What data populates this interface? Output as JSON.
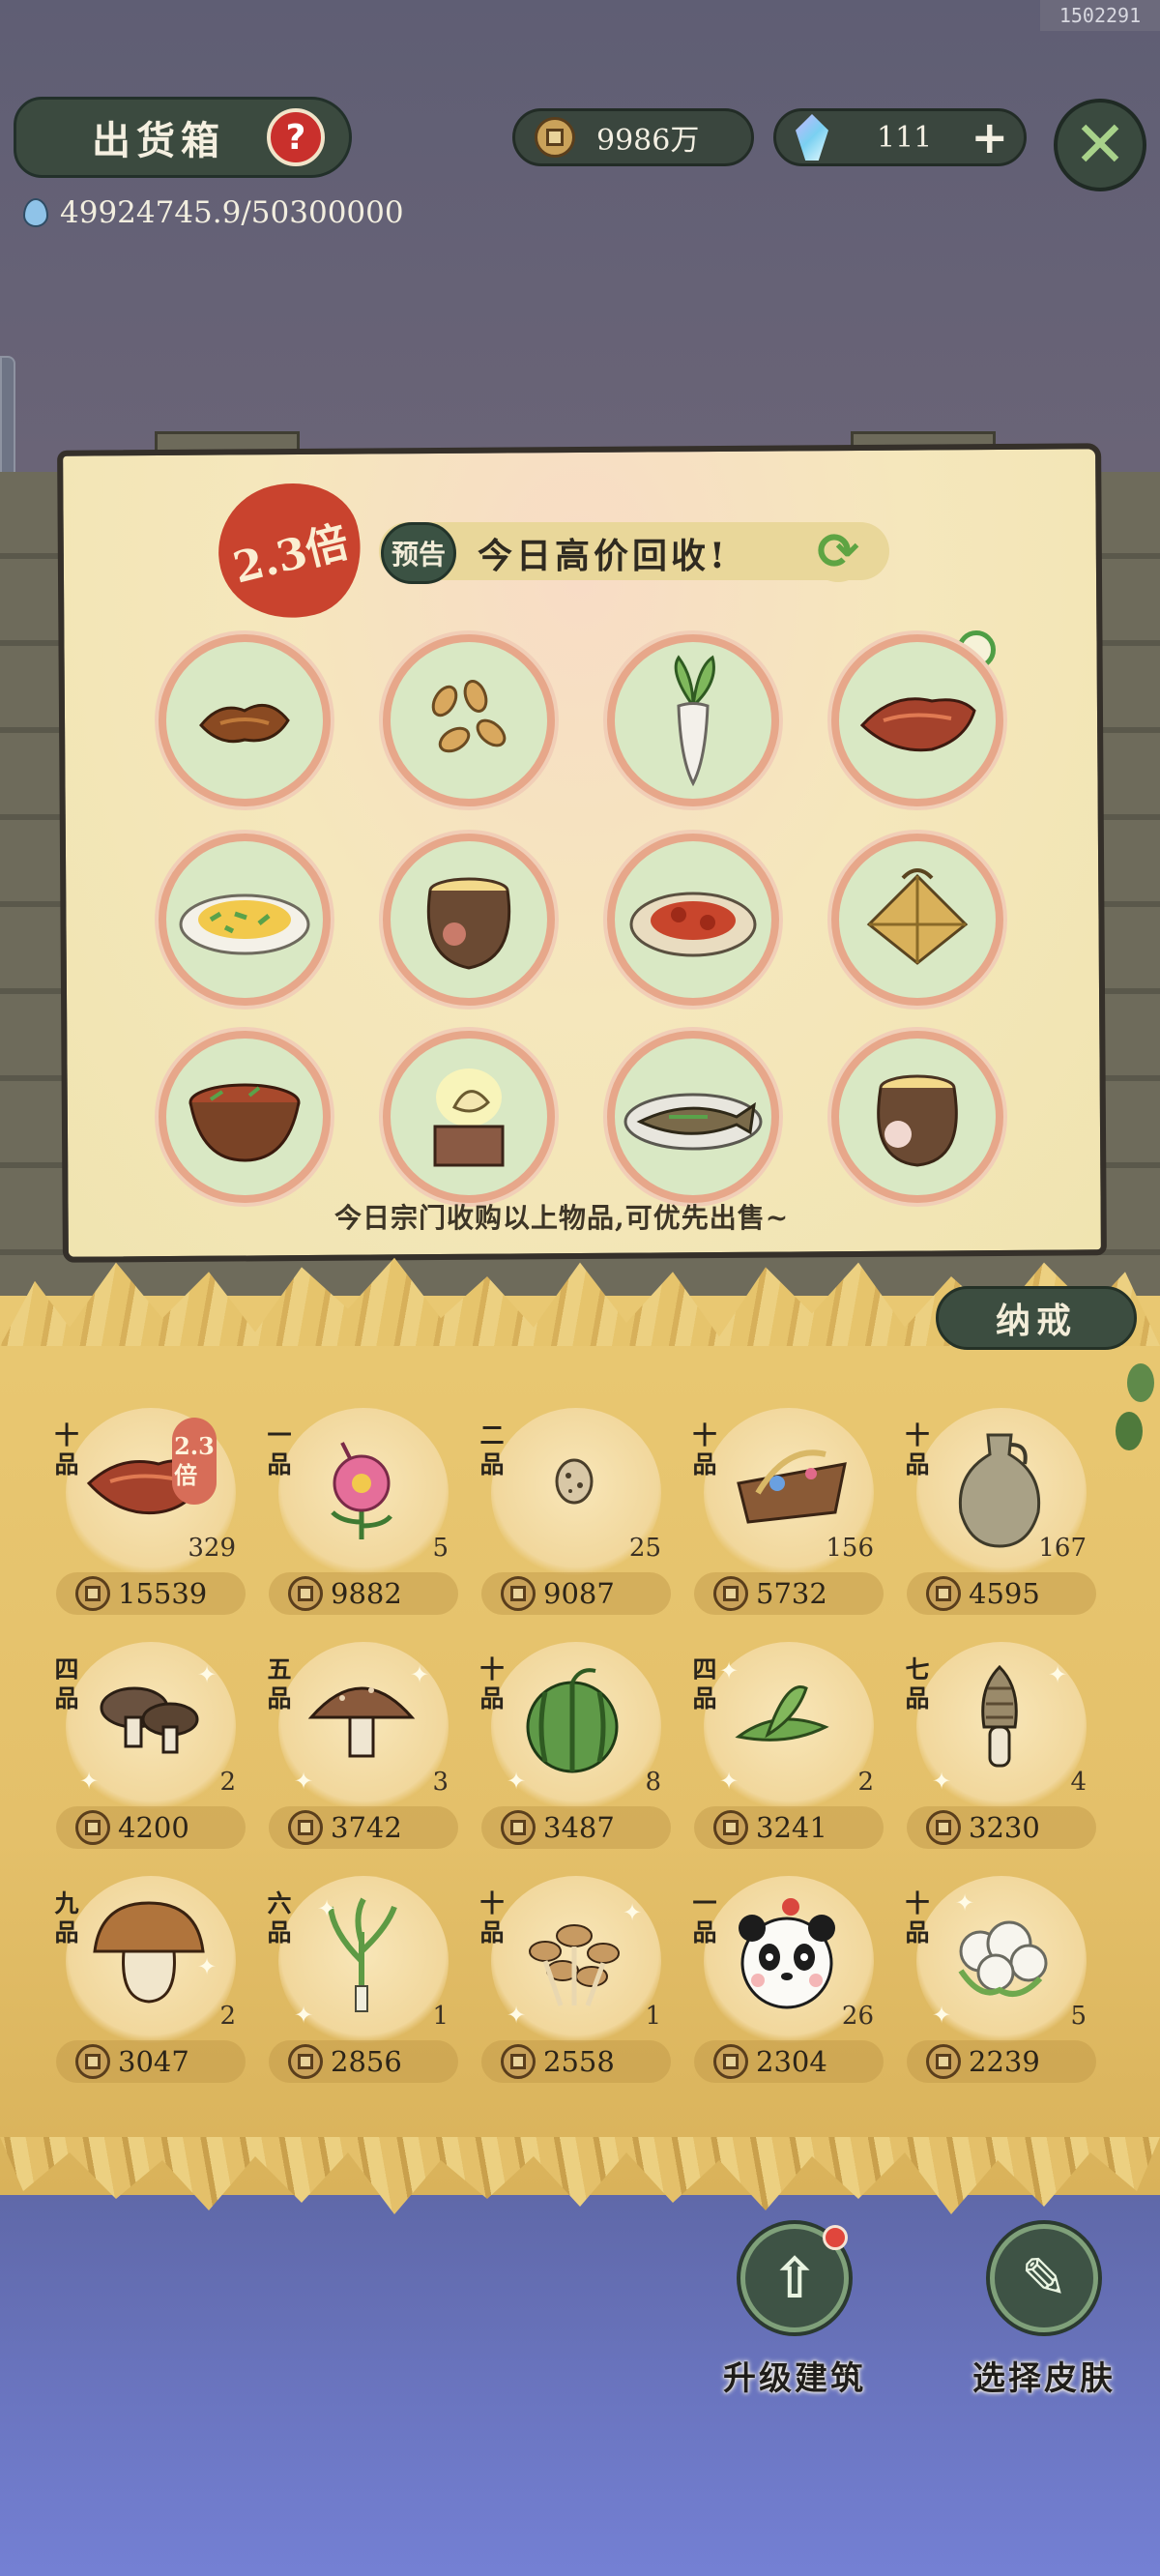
{
  "build_id": "1502291",
  "header": {
    "title": "出货箱",
    "help_icon": "question-icon",
    "energy": "49924745.9/50300000",
    "coins": "9986万",
    "gems": "111",
    "plus": "+",
    "close_icon": "close-icon"
  },
  "poster": {
    "bonus": "2.3倍",
    "preview_label": "预告",
    "banner": "今日高价回收!",
    "footer": "今日宗门收购以上物品,可优先出售~",
    "items": [
      {
        "icon": "roasted-meat-icon"
      },
      {
        "icon": "seeds-icon"
      },
      {
        "icon": "radish-icon"
      },
      {
        "icon": "braised-pork-icon"
      },
      {
        "icon": "fried-egg-dish-icon"
      },
      {
        "icon": "clay-pot-soup-icon"
      },
      {
        "icon": "sweet-sour-pork-icon"
      },
      {
        "icon": "zongzi-basket-icon"
      },
      {
        "icon": "meat-bowl-icon"
      },
      {
        "icon": "golden-pedestal-icon"
      },
      {
        "icon": "steamed-fish-icon"
      },
      {
        "icon": "porcelain-pot-icon"
      }
    ]
  },
  "inventory": {
    "tab": "纳戒",
    "items": [
      {
        "grade": "十品",
        "count": "329",
        "price": "15539",
        "icon": "braised-pork-icon",
        "bonus": "2.3倍"
      },
      {
        "grade": "一品",
        "count": "5",
        "price": "9882",
        "icon": "pink-flower-icon"
      },
      {
        "grade": "二品",
        "count": "25",
        "price": "9087",
        "icon": "quail-egg-icon"
      },
      {
        "grade": "十品",
        "count": "156",
        "price": "5732",
        "icon": "herb-bundle-icon"
      },
      {
        "grade": "十品",
        "count": "167",
        "price": "4595",
        "icon": "clay-jar-icon"
      },
      {
        "grade": "四品",
        "count": "2",
        "price": "4200",
        "icon": "shiitake-icon"
      },
      {
        "grade": "五品",
        "count": "3",
        "price": "3742",
        "icon": "brown-mushroom-icon"
      },
      {
        "grade": "十品",
        "count": "8",
        "price": "3487",
        "icon": "watermelon-icon"
      },
      {
        "grade": "四品",
        "count": "2",
        "price": "3241",
        "icon": "green-leaves-icon"
      },
      {
        "grade": "七品",
        "count": "4",
        "price": "3230",
        "icon": "morel-icon"
      },
      {
        "grade": "九品",
        "count": "2",
        "price": "3047",
        "icon": "porcini-icon"
      },
      {
        "grade": "六品",
        "count": "1",
        "price": "2856",
        "icon": "green-onion-icon"
      },
      {
        "grade": "十品",
        "count": "1",
        "price": "2558",
        "icon": "enoki-cluster-icon"
      },
      {
        "grade": "一品",
        "count": "26",
        "price": "2304",
        "icon": "panda-icon"
      },
      {
        "grade": "十品",
        "count": "5",
        "price": "2239",
        "icon": "cauliflower-icon"
      }
    ]
  },
  "actions": {
    "upgrade": "升级建筑",
    "skin": "选择皮肤"
  },
  "colors": {
    "accent_green": "#3b4a3f",
    "bonus_red": "#c9432e",
    "poster_bg": "#f5e7bc",
    "straw": "#e4c06a",
    "ring": "#e7a78a"
  }
}
